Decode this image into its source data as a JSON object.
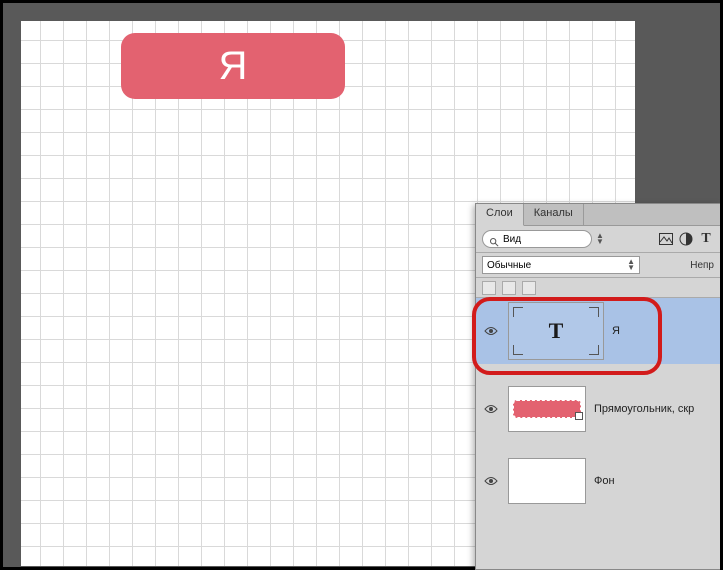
{
  "canvas": {
    "text_layer_content": "Я"
  },
  "panel": {
    "tabs": {
      "layers": "Слои",
      "channels": "Каналы"
    },
    "search": {
      "placeholder": "Вид"
    },
    "filter": {
      "selected": "Обычные",
      "opacity_label": "Непр"
    },
    "icons": {
      "image": "image-icon",
      "adjust": "adjust-icon",
      "text": "text-icon",
      "magnifier": "magnifier-icon",
      "eye": "eye-icon",
      "dropdown": "dropdown-icon"
    },
    "layers": [
      {
        "name": "Я",
        "type": "text",
        "visible": true,
        "selected": true,
        "thumb_glyph": "T"
      },
      {
        "name": "Прямоугольник, скр",
        "type": "shape",
        "visible": true,
        "selected": false
      },
      {
        "name": "Фон",
        "type": "background",
        "visible": true,
        "selected": false
      }
    ]
  },
  "colors": {
    "rect_fill": "#e36270",
    "selection_bg": "#a9c2e6",
    "highlight_border": "#d21b1b"
  }
}
